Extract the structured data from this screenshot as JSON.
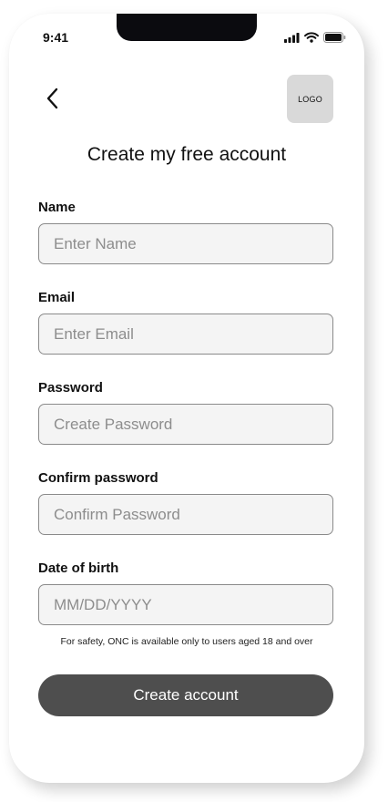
{
  "status_bar": {
    "time": "9:41"
  },
  "header": {
    "logo_text": "LOGO"
  },
  "title": "Create my free account",
  "form": {
    "name": {
      "label": "Name",
      "placeholder": "Enter Name"
    },
    "email": {
      "label": "Email",
      "placeholder": "Enter Email"
    },
    "password": {
      "label": "Password",
      "placeholder": "Create Password"
    },
    "confirm_password": {
      "label": "Confirm password",
      "placeholder": "Confirm Password"
    },
    "dob": {
      "label": "Date of birth",
      "placeholder": "MM/DD/YYYY"
    }
  },
  "disclaimer": "For safety, ONC is available only to users aged 18 and over",
  "submit_label": "Create account",
  "icons": {
    "back": "chevron-left-icon",
    "signal": "cellular-signal-icon",
    "wifi": "wifi-icon",
    "battery": "battery-icon"
  },
  "colors": {
    "button": "#4e4e4e",
    "input_bg": "#f4f4f4",
    "logo_bg": "#d9d9d9"
  }
}
